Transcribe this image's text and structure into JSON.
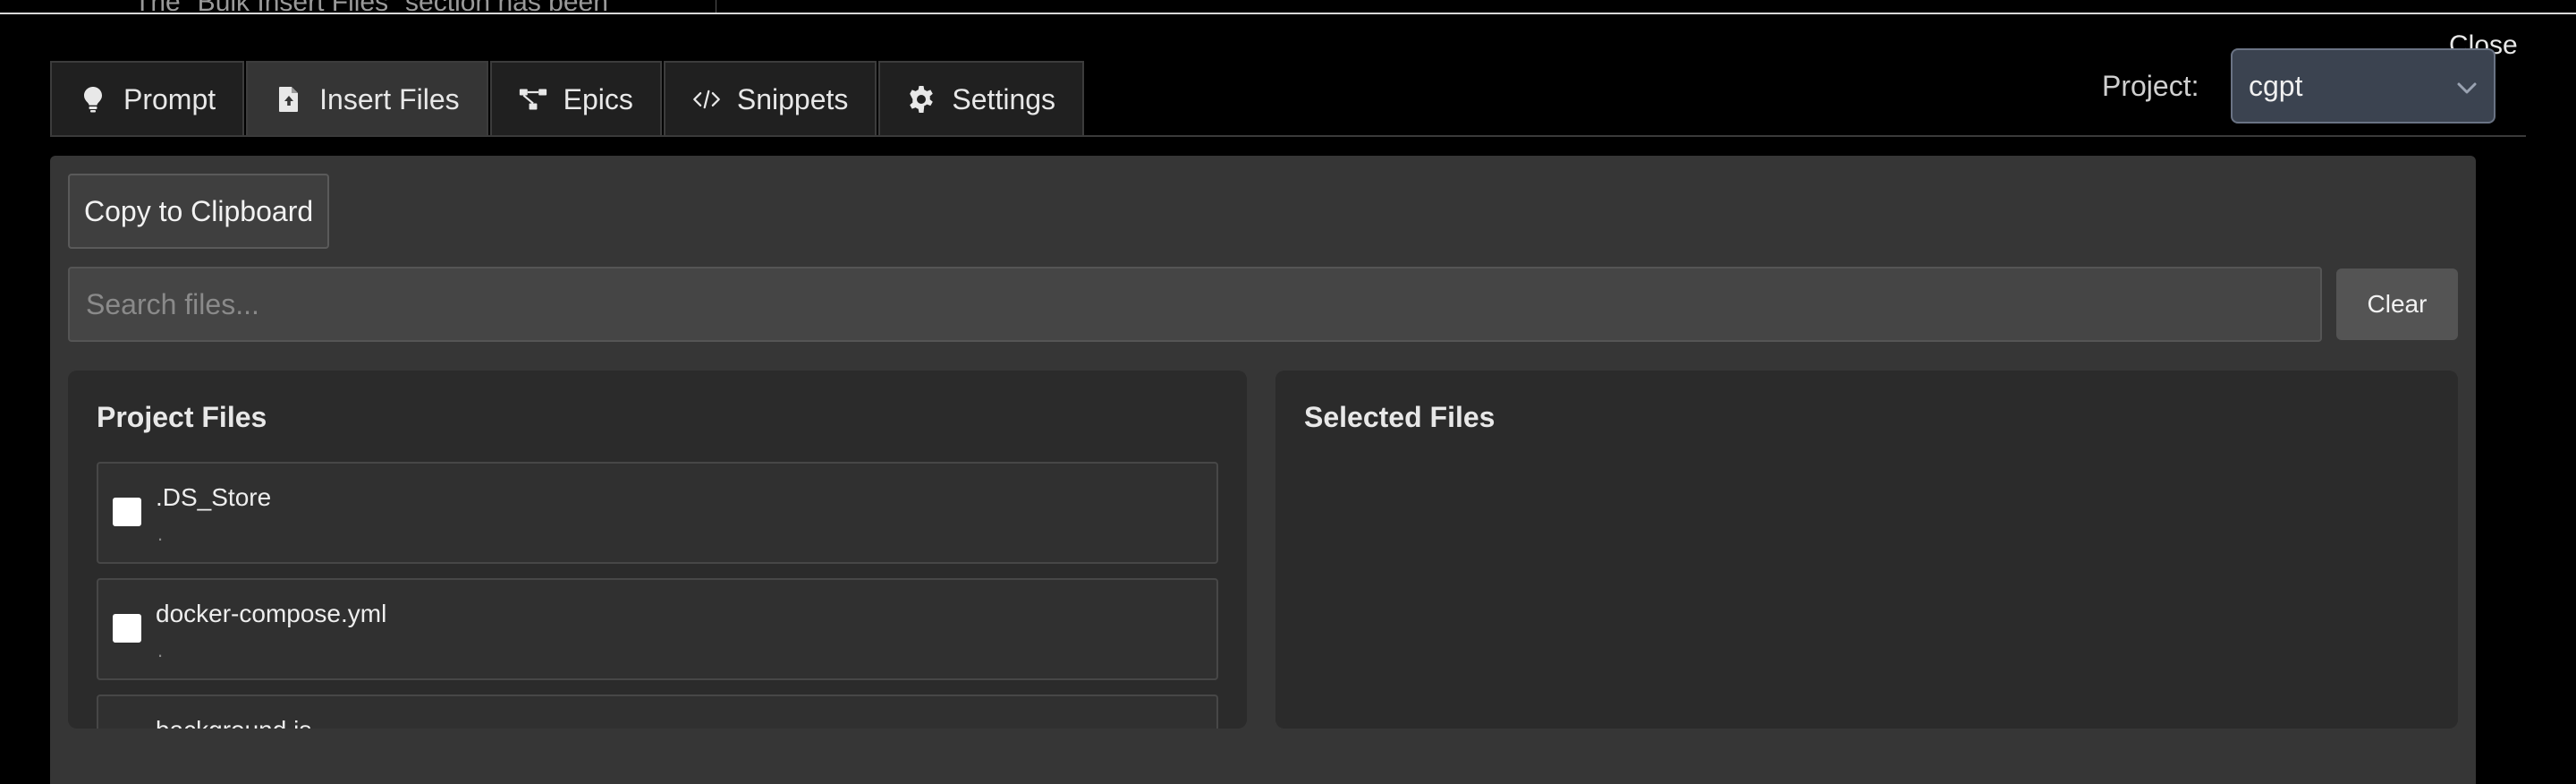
{
  "background": {
    "partial_text": "The \"Bulk Insert Files\" section has been"
  },
  "modal": {
    "close_label": "Close"
  },
  "tabs": [
    {
      "label": "Prompt",
      "icon": "lightbulb-icon",
      "active": false
    },
    {
      "label": "Insert Files",
      "icon": "file-upload-icon",
      "active": true
    },
    {
      "label": "Epics",
      "icon": "diagram-icon",
      "active": false
    },
    {
      "label": "Snippets",
      "icon": "code-icon",
      "active": false
    },
    {
      "label": "Settings",
      "icon": "gear-icon",
      "active": false
    }
  ],
  "project": {
    "label": "Project:",
    "selected": "cgpt"
  },
  "toolbar": {
    "copy_label": "Copy to Clipboard"
  },
  "search": {
    "placeholder": "Search files...",
    "value": "",
    "clear_label": "Clear"
  },
  "project_files": {
    "title": "Project Files",
    "items": [
      {
        "name": ".DS_Store",
        "path": "."
      },
      {
        "name": "docker-compose.yml",
        "path": "."
      },
      {
        "name": "background.js",
        "path": ""
      }
    ]
  },
  "selected_files": {
    "title": "Selected Files"
  },
  "colors": {
    "page_bg": "#000000",
    "panel_bg": "#363636",
    "box_bg": "#2b2b2b",
    "select_bg": "#3b4350"
  }
}
